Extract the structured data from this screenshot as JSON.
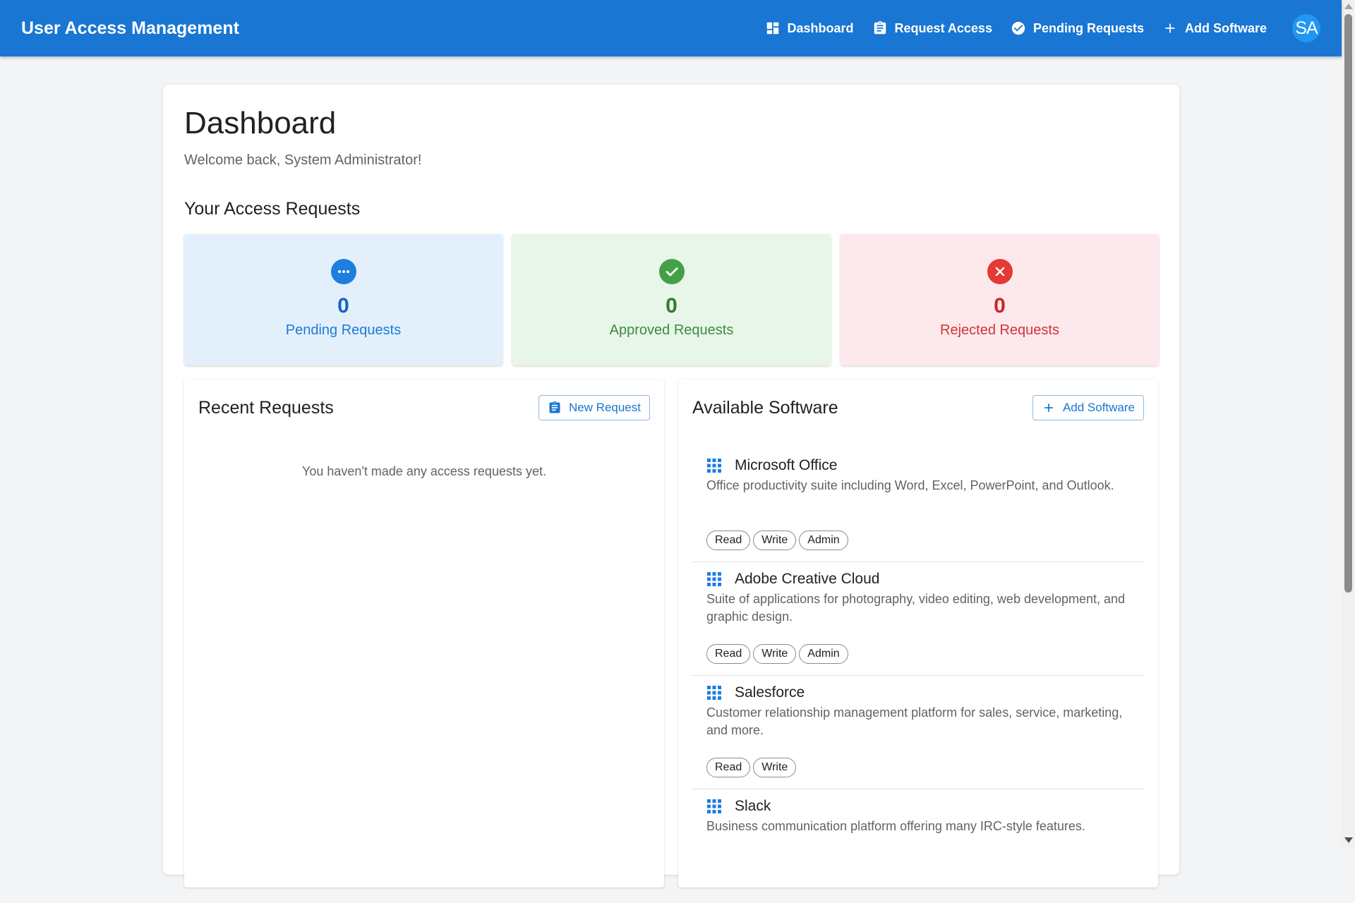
{
  "appbar": {
    "title": "User Access Management",
    "nav": [
      {
        "label": "Dashboard",
        "icon": "dashboard-icon"
      },
      {
        "label": "Request Access",
        "icon": "clipboard-icon"
      },
      {
        "label": "Pending Requests",
        "icon": "check-circle-icon"
      },
      {
        "label": "Add Software",
        "icon": "plus-icon"
      }
    ],
    "avatar": "SA"
  },
  "page": {
    "title": "Dashboard",
    "welcome": "Welcome back, System Administrator!",
    "section_title": "Your Access Requests"
  },
  "stats": {
    "pending": {
      "count": "0",
      "label": "Pending Requests",
      "color": "#1976d2"
    },
    "approved": {
      "count": "0",
      "label": "Approved Requests",
      "color": "#43a047"
    },
    "rejected": {
      "count": "0",
      "label": "Rejected Requests",
      "color": "#e53935"
    }
  },
  "recent": {
    "title": "Recent Requests",
    "button": "New Request",
    "empty": "You haven't made any access requests yet."
  },
  "software": {
    "title": "Available Software",
    "button": "Add Software",
    "items": [
      {
        "name": "Microsoft Office",
        "description": "Office productivity suite including Word, Excel, PowerPoint, and Outlook.",
        "permissions": [
          "Read",
          "Write",
          "Admin"
        ]
      },
      {
        "name": "Adobe Creative Cloud",
        "description": "Suite of applications for photography, video editing, web development, and graphic design.",
        "permissions": [
          "Read",
          "Write",
          "Admin"
        ]
      },
      {
        "name": "Salesforce",
        "description": "Customer relationship management platform for sales, service, marketing, and more.",
        "permissions": [
          "Read",
          "Write"
        ]
      },
      {
        "name": "Slack",
        "description": "Business communication platform offering many IRC-style features.",
        "permissions": []
      }
    ]
  }
}
